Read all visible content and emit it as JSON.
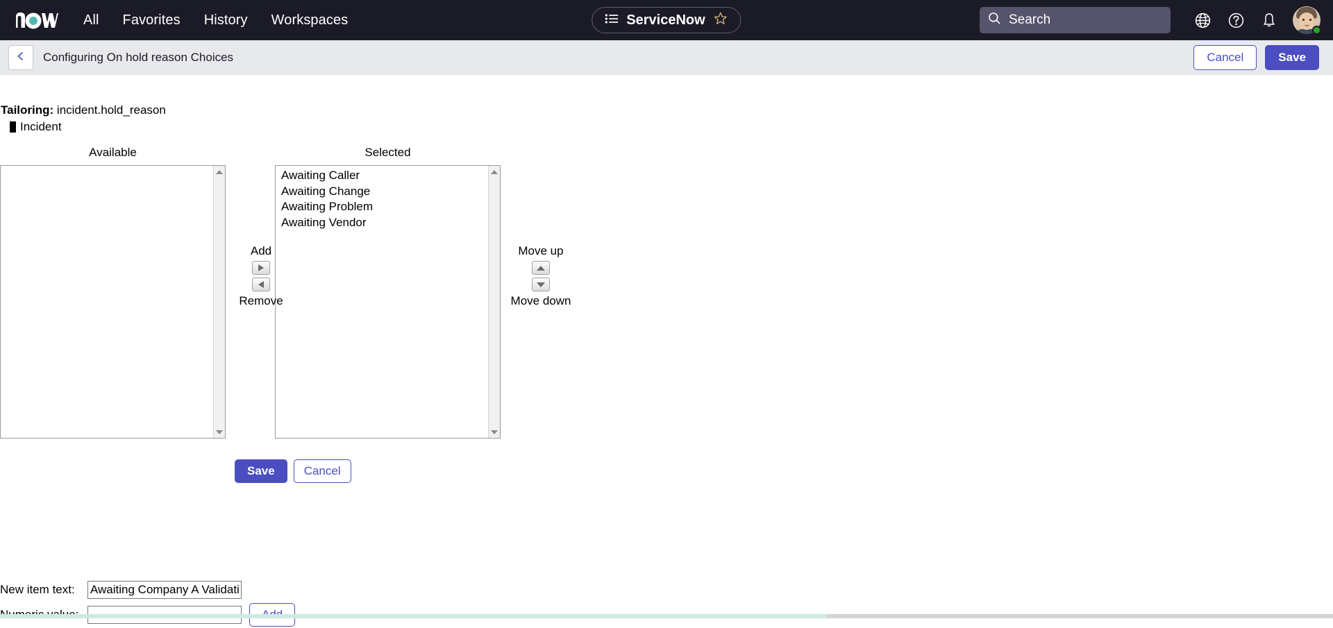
{
  "topnav": {
    "logo_name": "now",
    "links": [
      {
        "label": "All",
        "name": "nav-link-all"
      },
      {
        "label": "Favorites",
        "name": "nav-link-favorites"
      },
      {
        "label": "History",
        "name": "nav-link-history"
      },
      {
        "label": "Workspaces",
        "name": "nav-link-workspaces"
      }
    ],
    "center_pill": {
      "title": "ServiceNow",
      "menu_icon": "list-menu-icon",
      "favorite_icon": "star-outline-icon"
    },
    "search": {
      "placeholder": "Search",
      "value": "",
      "icon": "search-icon"
    },
    "icons": [
      {
        "name": "globe-icon",
        "title": "Language"
      },
      {
        "name": "help-circle-icon",
        "title": "Help"
      },
      {
        "name": "bell-icon",
        "title": "Notifications"
      }
    ],
    "avatar": {
      "name": "user-avatar",
      "presence": "online"
    }
  },
  "subbar": {
    "back_icon": "chevron-left-icon",
    "title": "Configuring On hold reason Choices",
    "cancel_label": "Cancel",
    "save_label": "Save"
  },
  "tailoring": {
    "label": "Tailoring:",
    "value": "incident.hold_reason",
    "table_name": "Incident"
  },
  "picker": {
    "available_header": "Available",
    "selected_header": "Selected",
    "available_items": [],
    "selected_items": [
      "Awaiting Caller",
      "Awaiting Change",
      "Awaiting Problem",
      "Awaiting Vendor"
    ],
    "add_label": "Add",
    "remove_label": "Remove",
    "move_up_label": "Move up",
    "move_down_label": "Move down",
    "save_label": "Save",
    "cancel_label": "Cancel"
  },
  "new_item": {
    "text_label": "New item text:",
    "text_value": "Awaiting Company A Validation",
    "text_placeholder": "",
    "numeric_label": "Numeric value:",
    "numeric_value": "",
    "numeric_placeholder": "",
    "add_label": "Add"
  },
  "colors": {
    "brand_dark": "#1b1a27",
    "accent_purple": "#4a4ec0",
    "now_teal": "#52b8b0",
    "subbar_bg": "#e8e9ed",
    "presence_green": "#28a428"
  }
}
